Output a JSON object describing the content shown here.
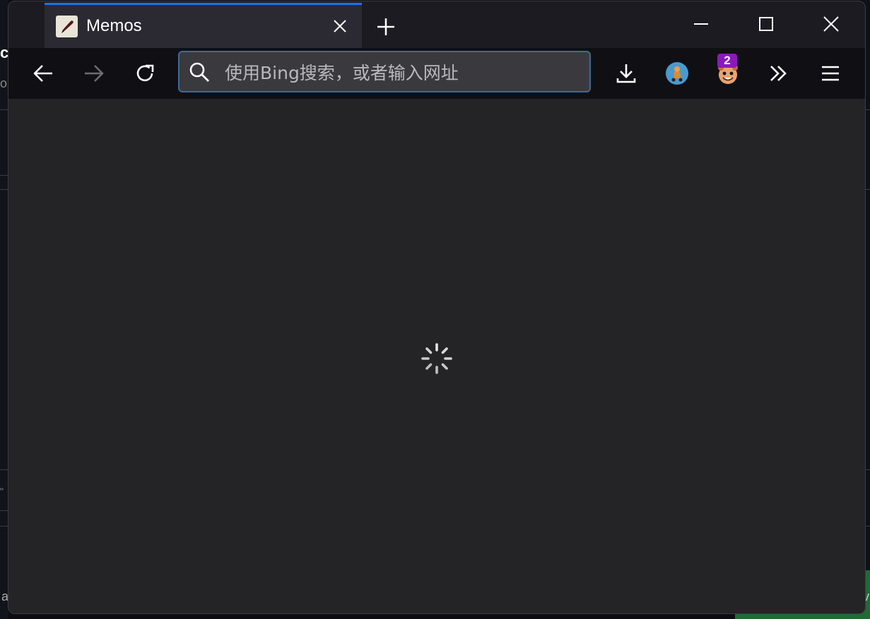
{
  "tab": {
    "title": "Memos",
    "close_label": "×"
  },
  "urlbar": {
    "placeholder": "使用Bing搜索，或者输入网址",
    "value": ""
  },
  "toolbar": {
    "back": "back-arrow-icon",
    "forward": "forward-arrow-icon",
    "reload": "reload-icon",
    "downloads": "download-icon",
    "extensions_overflow": "chevrons-right-icon",
    "menu": "hamburger-menu-icon",
    "extension_badge": "2"
  },
  "background": {
    "left_frag_1": "c",
    "left_frag_2": "or",
    "left_frag_3": "\"",
    "left_frag_4": "a",
    "right_frag": "v"
  },
  "colors": {
    "accent": "#1a73e8",
    "badge": "#8a1ab8",
    "page_bg": "#242427"
  }
}
